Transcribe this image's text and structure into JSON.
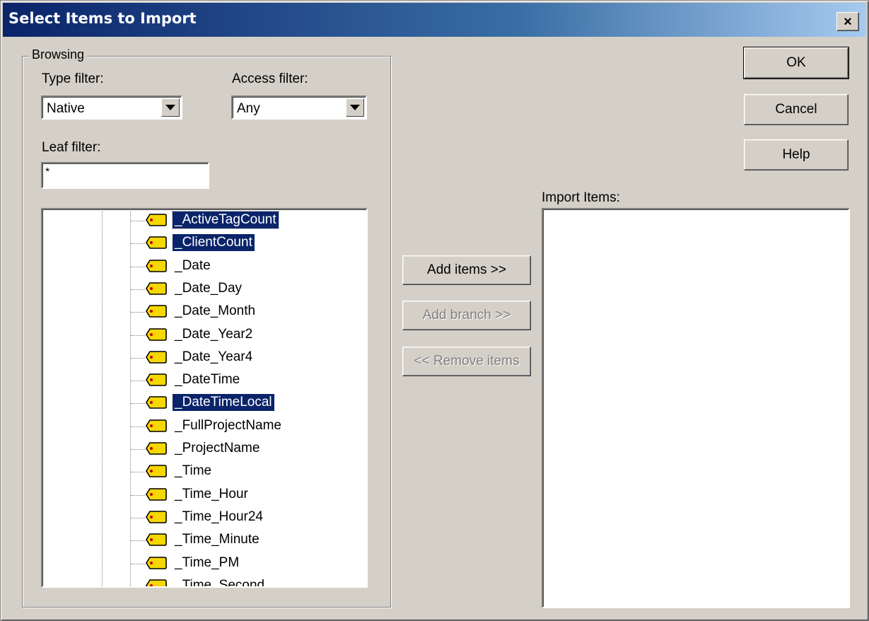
{
  "window": {
    "title": "Select Items to Import",
    "close_glyph": "×"
  },
  "browsing": {
    "group_label": "Browsing",
    "type_filter": {
      "label": "Type filter:",
      "value": "Native"
    },
    "access_filter": {
      "label": "Access filter:",
      "value": "Any"
    },
    "leaf_filter": {
      "label": "Leaf filter:",
      "value": "*"
    },
    "tree_items": [
      {
        "name": "_ActiveTagCount",
        "selected": true
      },
      {
        "name": "_ClientCount",
        "selected": true
      },
      {
        "name": "_Date",
        "selected": false
      },
      {
        "name": "_Date_Day",
        "selected": false
      },
      {
        "name": "_Date_Month",
        "selected": false
      },
      {
        "name": "_Date_Year2",
        "selected": false
      },
      {
        "name": "_Date_Year4",
        "selected": false
      },
      {
        "name": "_DateTime",
        "selected": false
      },
      {
        "name": "_DateTimeLocal",
        "selected": true
      },
      {
        "name": "_FullProjectName",
        "selected": false
      },
      {
        "name": "_ProjectName",
        "selected": false
      },
      {
        "name": "_Time",
        "selected": false
      },
      {
        "name": "_Time_Hour",
        "selected": false
      },
      {
        "name": "_Time_Hour24",
        "selected": false
      },
      {
        "name": "_Time_Minute",
        "selected": false
      },
      {
        "name": "_Time_PM",
        "selected": false
      },
      {
        "name": "_Time_Second",
        "selected": false
      }
    ]
  },
  "actions": {
    "add_items": "Add items >>",
    "add_branch": "Add branch >>",
    "remove_items": "<< Remove items"
  },
  "import": {
    "label": "Import Items:"
  },
  "buttons": {
    "ok": "OK",
    "cancel": "Cancel",
    "help": "Help"
  },
  "colors": {
    "face": "#d4d0c8",
    "title_start": "#0a246a",
    "title_end": "#a6caf0",
    "selection": "#0a246a",
    "tag_fill": "#f5d800"
  },
  "icons": {
    "tree_item": "tag-icon",
    "dropdown": "chevron-down-icon",
    "close": "close-icon"
  }
}
